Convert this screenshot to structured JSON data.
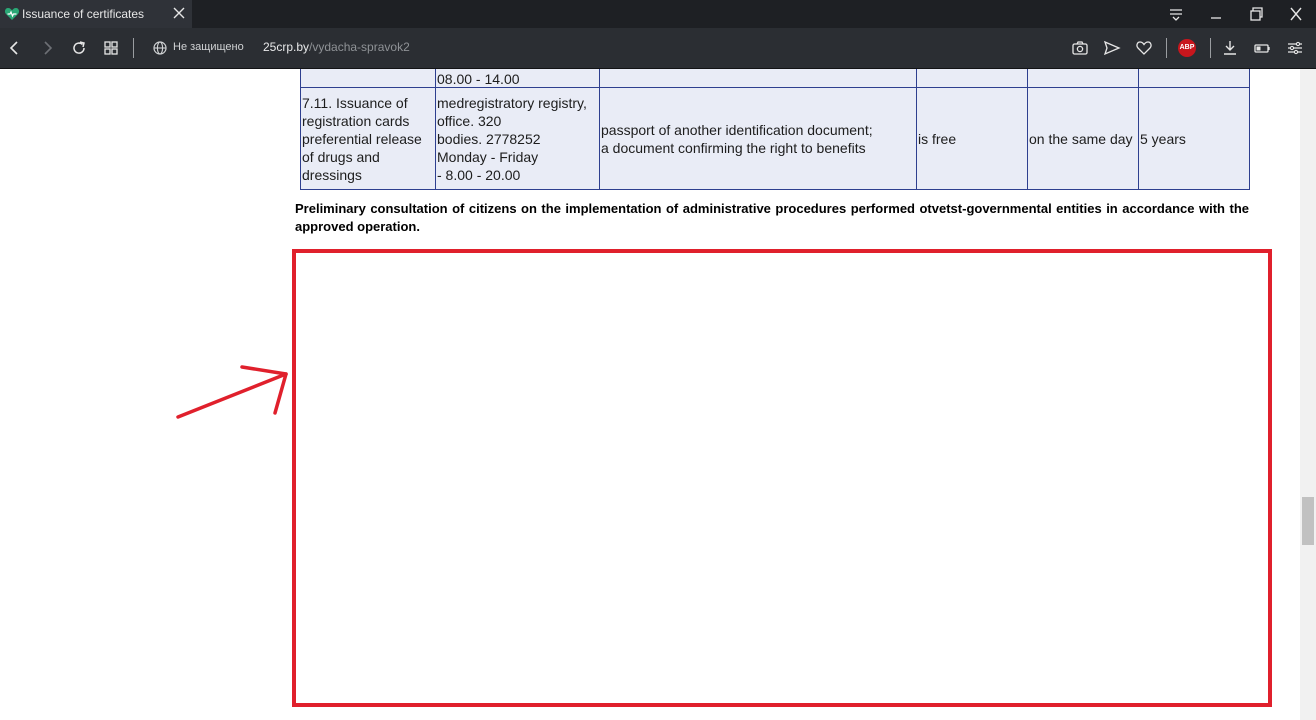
{
  "tab": {
    "title": "Issuance of certificates"
  },
  "address_bar": {
    "security_label": "Не защищено",
    "url_domain": "25crp.by",
    "url_path": "/vydacha-spravok2"
  },
  "extensions": {
    "adblock_label": "ABP"
  },
  "table": {
    "partial_row": {
      "hours": "08.00 - 14.00"
    },
    "row": {
      "procedure": "7.11. Issuance of registration cards preferential release of drugs and dressings",
      "office_line1": "medregistratory registry,",
      "office_line2": "office. 320",
      "office_line3": "bodies. 2778252",
      "office_line4": "Monday - Friday",
      "office_line5": "- 8.00 - 20.00",
      "documents_line1": "passport of another identification document;",
      "documents_line2": "a document confirming the right to benefits",
      "fee": "is free",
      "term": "on the same day",
      "validity": "5 years"
    }
  },
  "consultation_text": "Preliminary consultation of citizens on the implementation of administrative procedures performed otvetst-governmental entities in accordance with the approved operation.",
  "annotation": {
    "color": "#e0202c"
  },
  "colors": {
    "table_bg": "#e9ecf6",
    "table_border": "#2e3f8f",
    "toolbar_bg": "#2b2e33",
    "tab_bg": "#2f3238"
  }
}
